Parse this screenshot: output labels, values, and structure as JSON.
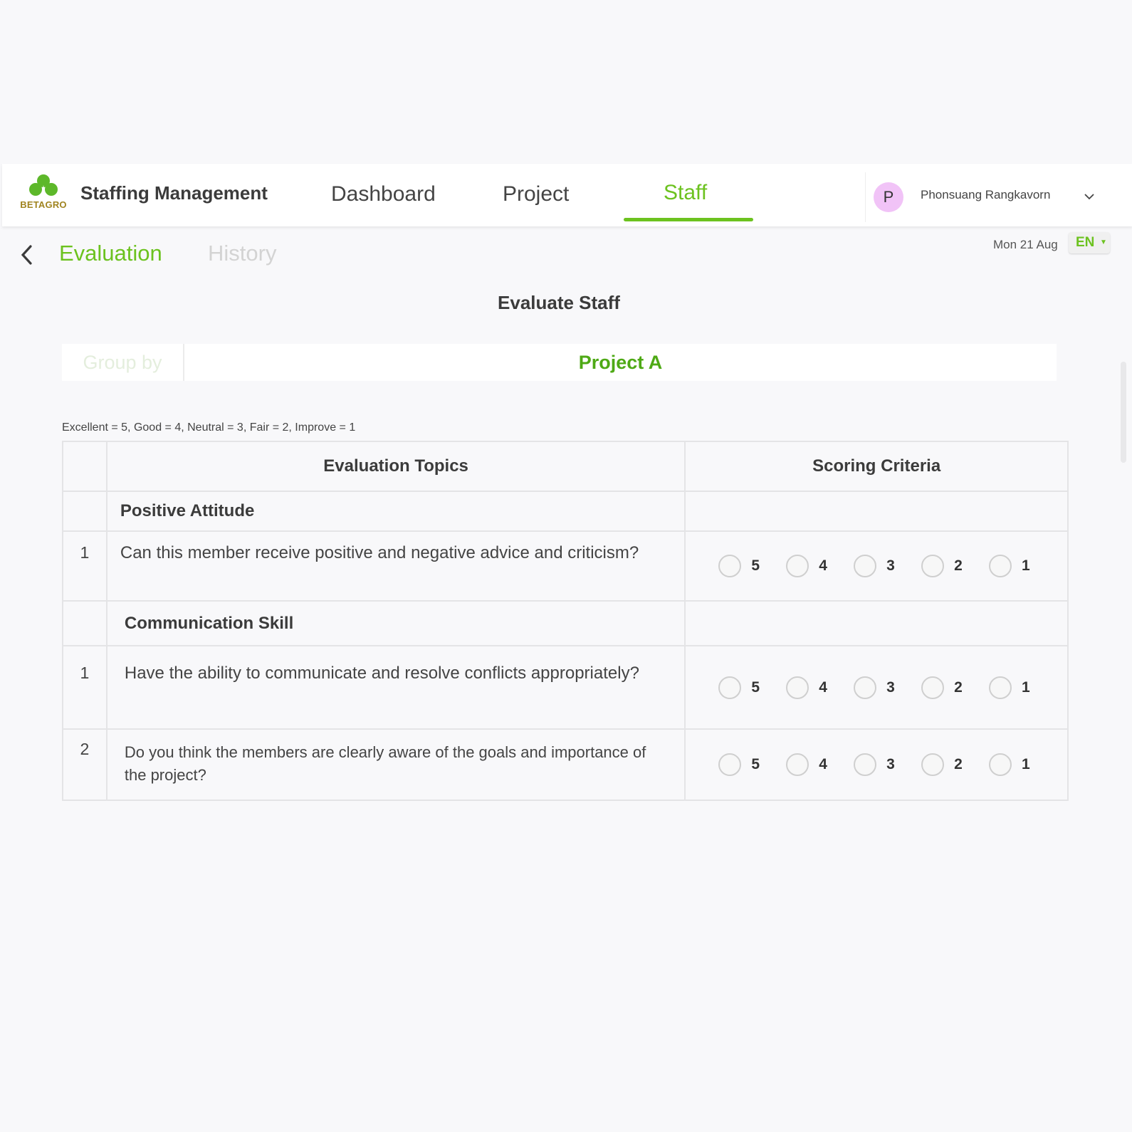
{
  "brand": {
    "logo_text": "BETAGRO",
    "app_title": "Staffing Management",
    "accent": "#6cc21f"
  },
  "nav": {
    "dashboard": "Dashboard",
    "project": "Project",
    "staff": "Staff",
    "active": "Staff"
  },
  "user": {
    "initial": "P",
    "name": "Phonsuang Rangkavorn"
  },
  "subnav": {
    "tab_evaluation": "Evaluation",
    "tab_history": "History",
    "active": "Evaluation"
  },
  "date": "Mon 21 Aug",
  "language": "EN",
  "page_title": "Evaluate Staff",
  "group_by": {
    "label": "Group by",
    "value": "Project  A"
  },
  "legend": "Excellent = 5, Good = 4, Neutral = 3, Fair = 2,   Improve = 1",
  "table": {
    "headers": {
      "topics": "Evaluation Topics",
      "scoring": "Scoring Criteria"
    },
    "score_options": [
      "5",
      "4",
      "3",
      "2",
      "1"
    ],
    "sections": [
      {
        "title": "Positive Attitude",
        "questions": [
          {
            "num": "1",
            "text": "Can this member receive positive and negative advice and criticism?"
          }
        ]
      },
      {
        "title": "Communication Skill",
        "questions": [
          {
            "num": "1",
            "text": "Have the ability to communicate and resolve conflicts appropriately?"
          },
          {
            "num": "2",
            "text": "Do you think the members are clearly aware of the goals and importance of the project?"
          }
        ]
      }
    ]
  }
}
